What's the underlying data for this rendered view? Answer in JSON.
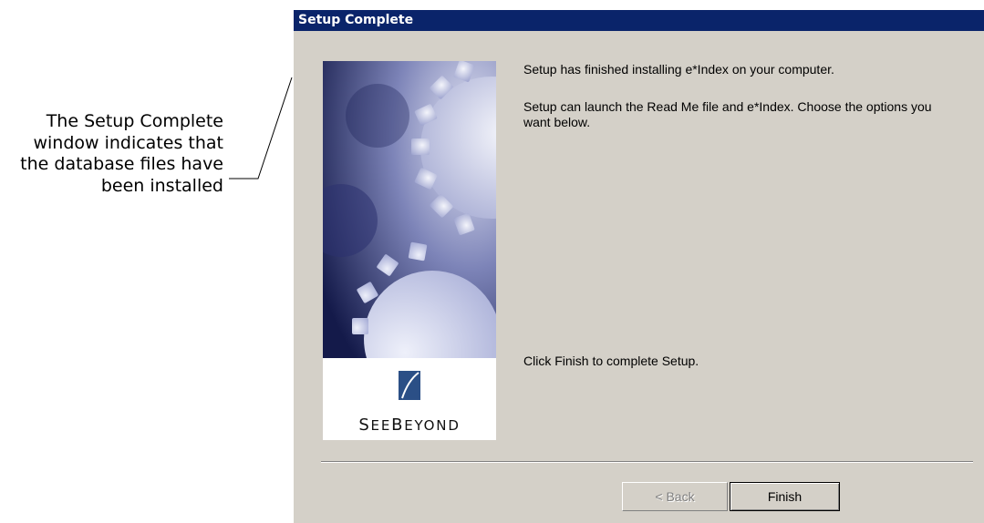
{
  "annotation": {
    "lines": [
      "The Setup Complete",
      "window indicates that",
      "the database files have",
      "been installed"
    ]
  },
  "dialog": {
    "title": "Setup Complete",
    "message_installed": "Setup has finished installing e*Index on your computer.",
    "message_launch": "Setup can launch the Read Me file and e*Index.  Choose the options you want below.",
    "message_finish": "Click Finish to complete Setup.",
    "brand": {
      "lead": "S",
      "rest1": "EE",
      "lead2": "B",
      "rest2": "EYOND"
    },
    "buttons": {
      "back": "< Back",
      "finish": "Finish"
    },
    "colors": {
      "titlebar": "#0a246a",
      "face": "#d4d0c8"
    }
  }
}
